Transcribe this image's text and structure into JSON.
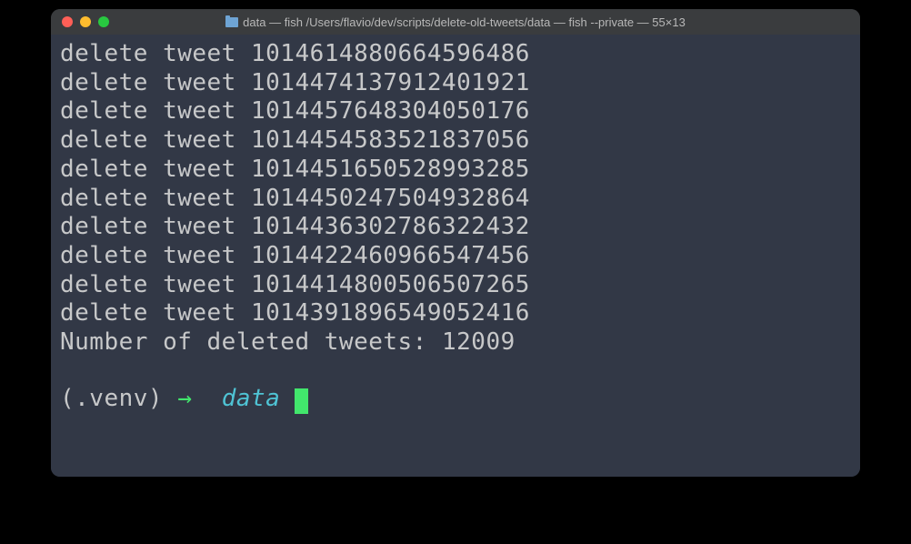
{
  "window": {
    "title": "data — fish /Users/flavio/dev/scripts/delete-old-tweets/data — fish --private — 55×13"
  },
  "output": {
    "lines": [
      "delete tweet 1014614880664596486",
      "delete tweet 1014474137912401921",
      "delete tweet 1014457648304050176",
      "delete tweet 1014454583521837056",
      "delete tweet 1014451650528993285",
      "delete tweet 1014450247504932864",
      "delete tweet 1014436302786322432",
      "delete tweet 1014422460966547456",
      "delete tweet 1014414800506507265",
      "delete tweet 1014391896549052416",
      "Number of deleted tweets: 12009"
    ]
  },
  "prompt": {
    "venv": "(.venv)",
    "arrow": "→",
    "dir": "data"
  }
}
